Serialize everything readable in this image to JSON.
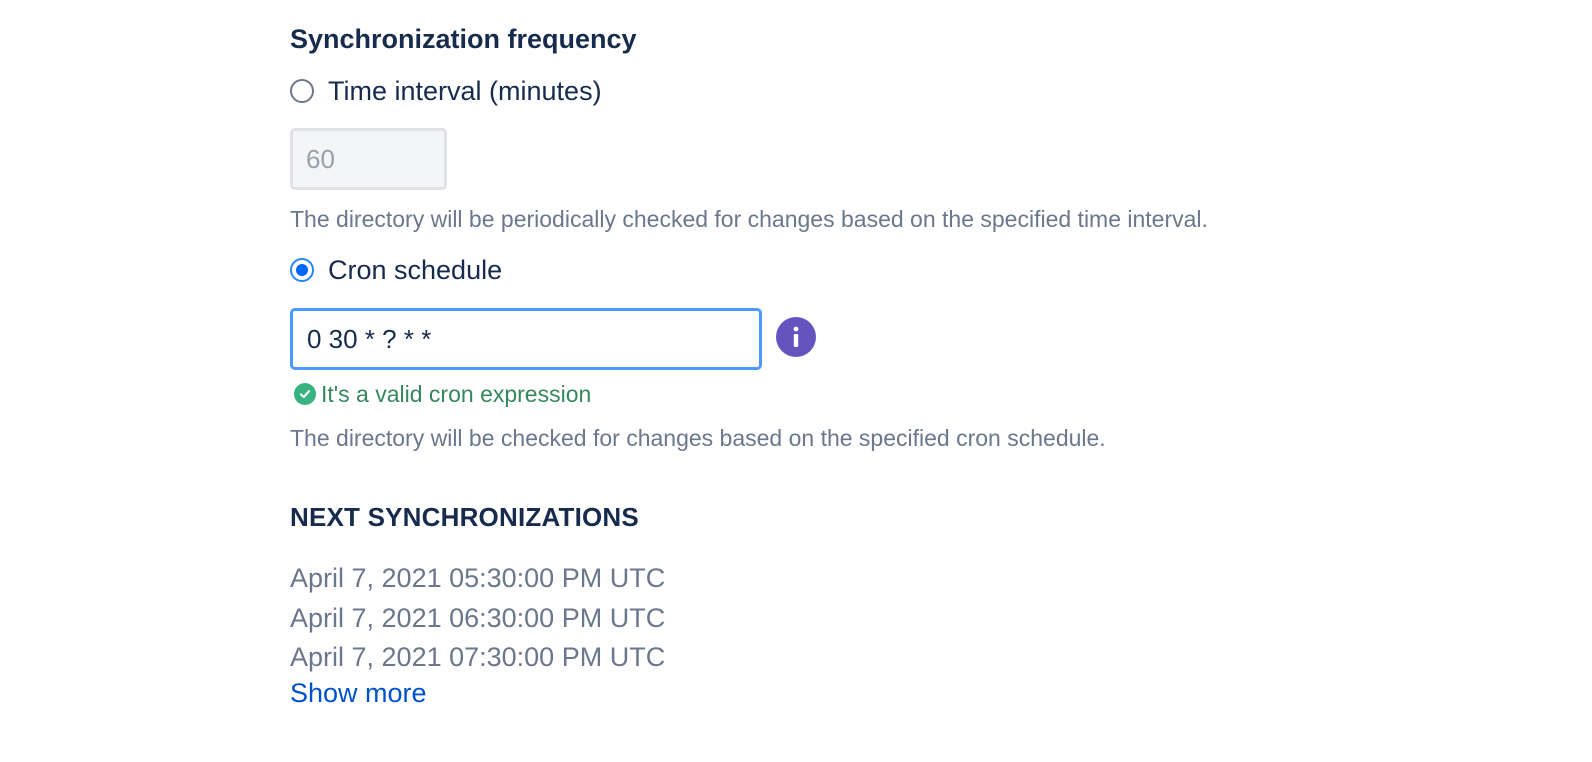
{
  "sync_frequency": {
    "title": "Synchronization frequency",
    "interval_option": {
      "label": "Time interval (minutes)",
      "selected": false,
      "placeholder": "60",
      "help": "The directory will be periodically checked for changes based on the specified time interval."
    },
    "cron_option": {
      "label": "Cron schedule",
      "selected": true,
      "value": "0 30 * ? * *",
      "validation": "It's a valid cron expression",
      "help": "The directory will be checked for changes based on the specified cron schedule."
    }
  },
  "next_synchronizations": {
    "title": "NEXT SYNCHRONIZATIONS",
    "items": [
      "April 7, 2021 05:30:00 PM UTC",
      "April 7, 2021 06:30:00 PM UTC",
      "April 7, 2021 07:30:00 PM UTC"
    ],
    "show_more_label": "Show more"
  },
  "icons": {
    "info": "info-icon",
    "valid": "check-circle-icon"
  },
  "colors": {
    "title": "#172B4D",
    "muted": "#6B778C",
    "radio_selected": "#0065FF",
    "input_focus_border": "#4C9AFF",
    "info_icon": "#6554C0",
    "success": "#36B37E",
    "link": "#0052CC"
  }
}
